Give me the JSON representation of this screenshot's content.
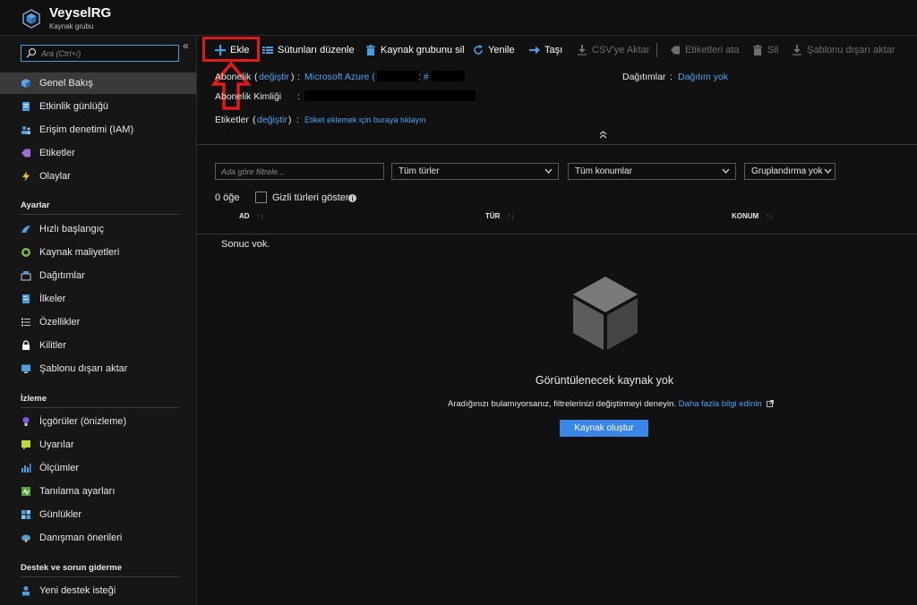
{
  "header": {
    "title": "VeyselRG",
    "subtitle": "Kaynak grubu"
  },
  "sidebar": {
    "search_placeholder": "Ara (Ctrl+/)",
    "collapse_glyph": "«",
    "items": [
      {
        "label": "Genel Bakış",
        "icon": "resource-group-icon",
        "active": true
      },
      {
        "label": "Etkinlik günlüğü",
        "icon": "activity-log-icon"
      },
      {
        "label": "Erişim denetimi (IAM)",
        "icon": "iam-icon"
      },
      {
        "label": "Etiketler",
        "icon": "tag-icon"
      },
      {
        "label": "Olaylar",
        "icon": "lightning-icon"
      }
    ],
    "sections": [
      {
        "header": "Ayarlar",
        "items": [
          {
            "label": "Hızlı başlangıç",
            "icon": "quickstart-icon"
          },
          {
            "label": "Kaynak maliyetleri",
            "icon": "cost-icon"
          },
          {
            "label": "Dağıtımlar",
            "icon": "deployments-icon"
          },
          {
            "label": "İlkeler",
            "icon": "policy-icon"
          },
          {
            "label": "Özellikler",
            "icon": "properties-icon"
          },
          {
            "label": "Kilitler",
            "icon": "lock-icon"
          },
          {
            "label": "Şablonu dışarı aktar",
            "icon": "export-template-icon"
          }
        ]
      },
      {
        "header": "İzleme",
        "items": [
          {
            "label": "İçgörüler (önizleme)",
            "icon": "insights-icon"
          },
          {
            "label": "Uyarılar",
            "icon": "alerts-icon"
          },
          {
            "label": "Ölçümler",
            "icon": "metrics-icon"
          },
          {
            "label": "Tanılama ayarları",
            "icon": "diagnostics-icon"
          },
          {
            "label": "Günlükler",
            "icon": "logs-icon"
          },
          {
            "label": "Danışman önerileri",
            "icon": "advisor-icon"
          }
        ]
      },
      {
        "header": "Destek ve sorun giderme",
        "items": [
          {
            "label": "Yeni destek isteği",
            "icon": "support-icon"
          }
        ]
      }
    ]
  },
  "toolbar": {
    "add": "Ekle",
    "edit_columns": "Sütunları düzenle",
    "delete_rg": "Kaynak grubunu sil",
    "refresh": "Yenile",
    "move": "Taşı",
    "export_csv": "CSV'ye Aktar",
    "assign_tags": "Etiketleri ata",
    "delete": "Sil",
    "export_template": "Şablonu dışarı aktar"
  },
  "essentials": {
    "subscription_label": "Abonelik",
    "change_link": "değiştir",
    "subscription_value_prefix": "Microsoft Azure (",
    "subscription_value_hash": ": #",
    "subscription_id_label": "Abonelik Kimliği",
    "tags_label": "Etiketler",
    "tags_link": "Etiket eklemek için buraya tıklayın",
    "deployments_label": "Dağıtımlar",
    "deployments_value": "Dağıtım yok",
    "colon": ":",
    "open_paren": "(",
    "close_paren": ")",
    "collapse_glyph": "⌃"
  },
  "filters": {
    "name_placeholder": "Ada göre filtrele...",
    "types": "Tüm türler",
    "locations": "Tüm konumlar",
    "grouping": "Gruplandırma yok"
  },
  "list": {
    "count": "0 öğe",
    "show_hidden": "Gizli türleri göster",
    "show_hidden_checked": false,
    "columns": [
      "AD",
      "TÜR",
      "KONUM"
    ],
    "sort_glyph": "↑↓",
    "no_results": "Sonuc vok."
  },
  "empty_state": {
    "title": "Görüntülenecek kaynak yok",
    "description": "Aradığınızı bulamıyorsanız, filtrelerinizi değiştirmeyi deneyin.",
    "learn_more": "Daha fazla bilgi edinin",
    "create_button": "Kaynak oluştur"
  },
  "colors": {
    "accent": "#4aa3f0",
    "primary_button": "#3a86e6",
    "highlight": "#e01b1b",
    "active_nav": "#3a3a3a"
  }
}
